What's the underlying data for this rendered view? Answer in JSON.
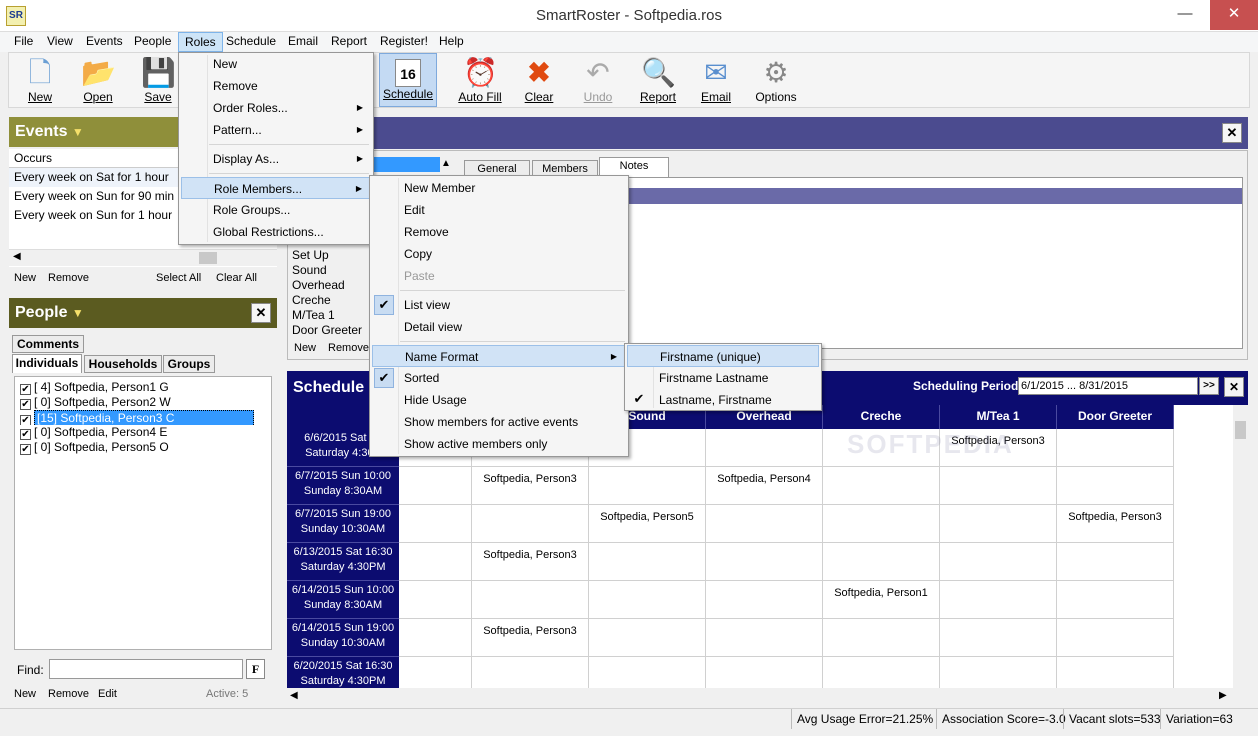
{
  "window": {
    "title": "SmartRoster - Softpedia.ros",
    "icon": "SR",
    "minimize": "—",
    "maximize": "☐",
    "close": "✕"
  },
  "menubar": [
    "File",
    "View",
    "Events",
    "People",
    "Roles",
    "Schedule",
    "Email",
    "Report",
    "Register!",
    "Help"
  ],
  "toolbar": {
    "new": "New",
    "open": "Open",
    "save": "Save",
    "schedule": "Schedule",
    "autofill": "Auto Fill",
    "clear": "Clear",
    "undo": "Undo",
    "report": "Report",
    "email": "Email",
    "options": "Options"
  },
  "events": {
    "header": "Events",
    "column": "Occurs",
    "rows": [
      "Every week on Sat for 1 hour",
      "Every week on Sun for 90 min",
      "Every week on Sun for 1 hour"
    ],
    "links": {
      "new": "New",
      "remove": "Remove",
      "select_all": "Select All",
      "clear_all": "Clear All"
    }
  },
  "people": {
    "header": "People",
    "tabs": {
      "comments": "Comments",
      "individuals": "Individuals",
      "households": "Households",
      "groups": "Groups"
    },
    "rows": [
      "[ 4] Softpedia, Person1 G",
      "[ 0] Softpedia, Person2 W",
      "[15] Softpedia, Person3 C",
      "[ 0] Softpedia, Person4 E",
      "[ 0] Softpedia, Person5 O"
    ],
    "find_label": "Find:",
    "find_button": "F",
    "links": {
      "new": "New",
      "remove": "Remove",
      "edit": "Edit",
      "active": "Active: 5"
    }
  },
  "roles_panel": {
    "tabs": {
      "general": "General",
      "members": "Members",
      "notes": "Notes"
    },
    "roles": [
      "Set Up",
      "Sound",
      "Overhead",
      "Creche",
      "M/Tea 1",
      "Door Greeter"
    ],
    "links": {
      "new": "New",
      "remove": "Remove"
    }
  },
  "schedule": {
    "header": "Schedule",
    "period_label": "Scheduling Period",
    "period_value": "6/1/2015 ... 8/31/2015",
    "next_button": ">>",
    "watermark": "SOFTPEDIA",
    "columns": [
      "Sound",
      "Overhead",
      "Creche",
      "M/Tea 1",
      "Door Greeter"
    ],
    "rows": [
      {
        "date": "6/6/2015 Sat 16",
        "name": "Saturday 4:30P",
        "cells": [
          "",
          "",
          "",
          "",
          "",
          "Softpedia, Person3",
          ""
        ]
      },
      {
        "date": "6/7/2015 Sun 10:00",
        "name": "Sunday 8:30AM",
        "cells": [
          "",
          "Softpedia, Person3",
          "",
          "Softpedia, Person4",
          "",
          "",
          ""
        ]
      },
      {
        "date": "6/7/2015 Sun 19:00",
        "name": "Sunday 10:30AM",
        "cells": [
          "",
          "",
          "Softpedia, Person5",
          "",
          "",
          "",
          "Softpedia, Person3"
        ]
      },
      {
        "date": "6/13/2015 Sat 16:30",
        "name": "Saturday 4:30PM",
        "cells": [
          "",
          "Softpedia, Person3",
          "",
          "",
          "",
          "",
          ""
        ]
      },
      {
        "date": "6/14/2015 Sun 10:00",
        "name": "Sunday 8:30AM",
        "cells": [
          "",
          "",
          "",
          "",
          "Softpedia, Person1",
          "",
          ""
        ]
      },
      {
        "date": "6/14/2015 Sun 19:00",
        "name": "Sunday 10:30AM",
        "cells": [
          "",
          "Softpedia, Person3",
          "",
          "",
          "",
          "",
          ""
        ]
      },
      {
        "date": "6/20/2015 Sat 16:30",
        "name": "Saturday 4:30PM",
        "cells": [
          "",
          "",
          "",
          "",
          "",
          "",
          ""
        ]
      }
    ]
  },
  "roles_menu": [
    "New",
    "Remove",
    "Order Roles...",
    "Pattern...",
    "Display As...",
    "Role Members...",
    "Role Groups...",
    "Global Restrictions..."
  ],
  "members_menu": [
    "New Member",
    "Edit",
    "Remove",
    "Copy",
    "Paste",
    "List view",
    "Detail view",
    "Name Format",
    "Sorted",
    "Hide Usage",
    "Show members for active events",
    "Show active members only"
  ],
  "name_format_menu": [
    "Firstname (unique)",
    "Firstname Lastname",
    "Lastname, Firstname"
  ],
  "status": {
    "avg": "Avg Usage Error=21.25%",
    "assoc": "Association Score=-3.0",
    "vacant": "Vacant slots=533",
    "variation": "Variation=63"
  },
  "colors": {
    "events_header": "#8f8f3a",
    "people_header": "#5b5b20",
    "schedule_header": "#0c0c70",
    "panel_band": "#4b4b8f"
  }
}
